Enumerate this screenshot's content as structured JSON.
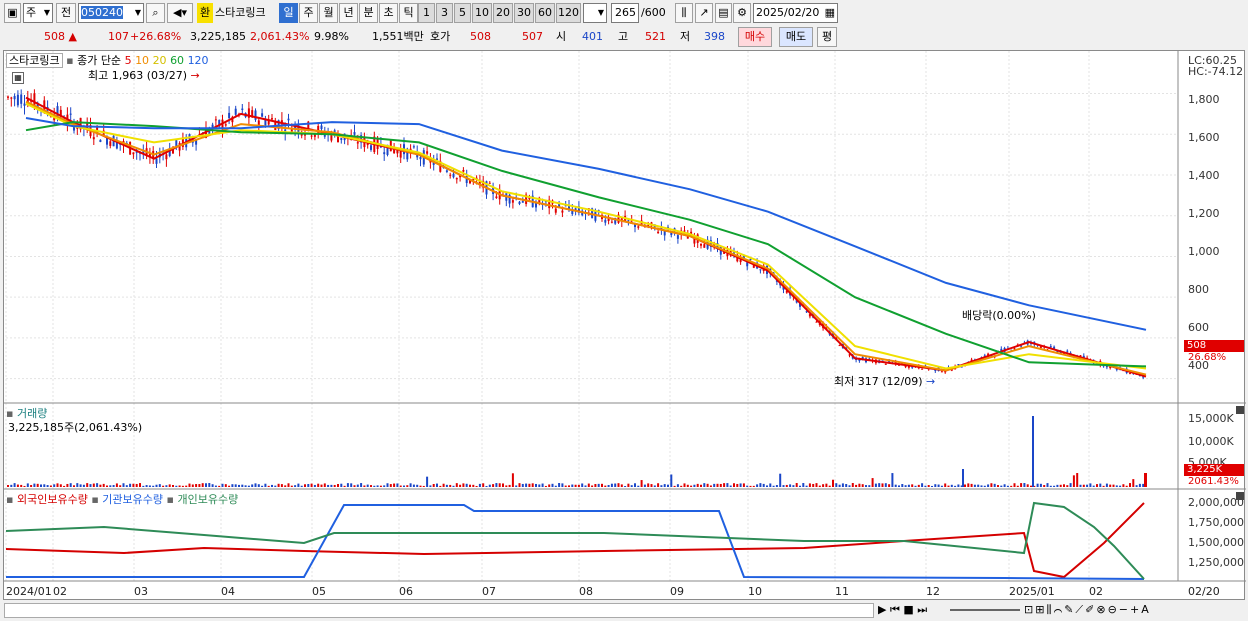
{
  "toolbar": {
    "type_sel": "주",
    "jeon": "전",
    "code": "050240",
    "hwan": "환",
    "stock_name": "스타코링크",
    "periods": [
      "일",
      "주",
      "월",
      "년",
      "분",
      "초",
      "틱"
    ],
    "active_period": "일",
    "minute_units": [
      "1",
      "3",
      "5",
      "10",
      "20",
      "30",
      "60",
      "120"
    ],
    "count": "265",
    "count_max": "/600",
    "date": "2025/02/20"
  },
  "quote": {
    "price": "508 ▲",
    "change": "107",
    "change_pct": "+26.68%",
    "volume": "3,225,185",
    "volume_pct": "2,061.43%",
    "turnover_pct": "9.98%",
    "amount": "1,551백만",
    "hoga_label": "호가",
    "ask": "508",
    "bid": "507",
    "open_label": "시",
    "open": "401",
    "high_label": "고",
    "high": "521",
    "low_label": "저",
    "low": "398",
    "buy": "매수",
    "sell": "매도",
    "even": "평"
  },
  "price_panel": {
    "name": "스타코링크",
    "ma_title": "종가 단순",
    "ma_5": "5",
    "ma_10": "10",
    "ma_20": "20",
    "ma_60": "60",
    "ma_120": "120",
    "high_note": "최고 1,963 (03/27)",
    "low_note": "최저 317 (12/09)",
    "dividend_note": "배당락(0.00%)",
    "lc": "LC:60.25",
    "hc": "HC:-74.12",
    "cur_price": "508",
    "cur_pct": "26.68%",
    "y_ticks": [
      "1,800",
      "1,600",
      "1,400",
      "1,200",
      "1,000",
      "800",
      "600",
      "400"
    ]
  },
  "volume_panel": {
    "title": "거래량",
    "value": "3,225,185주(2,061.43%)",
    "y_ticks": [
      "15,000K",
      "10,000K",
      "5,000K"
    ],
    "cur_volume": "3,225K",
    "cur_pct": "2061.43%"
  },
  "holding_panel": {
    "foreign": "외국인보유수량",
    "inst": "기관보유수량",
    "indiv": "개인보유수량",
    "y_ticks": [
      "2,000,000",
      "1,750,000",
      "1,500,000",
      "1,250,000"
    ]
  },
  "x_axis": {
    "labels": [
      "2024/01",
      "02",
      "03",
      "04",
      "05",
      "06",
      "07",
      "08",
      "09",
      "10",
      "11",
      "12",
      "2025/01",
      "02"
    ],
    "last_date": "02/20"
  },
  "colors": {
    "ma5": "#e00000",
    "ma10": "#f08c00",
    "ma20": "#f0e000",
    "ma60": "#10a030",
    "ma120": "#2060e0",
    "up": "#e00000",
    "down": "#1a46c8",
    "foreign": "#d40000",
    "inst": "#2060e0",
    "indiv": "#2e8b57"
  },
  "chart_data": {
    "type": "line",
    "title": "스타코링크",
    "x": [
      "2024/01",
      "02",
      "03",
      "04",
      "05",
      "06",
      "07",
      "08",
      "09",
      "10",
      "11",
      "12",
      "2025/01",
      "02"
    ],
    "series": [
      {
        "name": "5",
        "values": [
          1780,
          1660,
          1480,
          1700,
          1600,
          1500,
          1300,
          1200,
          1100,
          930,
          500,
          440,
          580,
          410
        ]
      },
      {
        "name": "10",
        "values": [
          1760,
          1650,
          1500,
          1650,
          1610,
          1500,
          1300,
          1200,
          1100,
          940,
          520,
          440,
          560,
          420
        ]
      },
      {
        "name": "20",
        "values": [
          1750,
          1640,
          1560,
          1620,
          1600,
          1510,
          1320,
          1220,
          1110,
          960,
          560,
          450,
          520,
          450
        ]
      },
      {
        "name": "60",
        "values": [
          1620,
          1660,
          1640,
          1610,
          1600,
          1560,
          1420,
          1290,
          1180,
          1060,
          800,
          620,
          480,
          460
        ]
      },
      {
        "name": "120",
        "values": [
          1680,
          1640,
          1630,
          1630,
          1660,
          1650,
          1520,
          1430,
          1330,
          1220,
          1050,
          870,
          760,
          640
        ]
      }
    ],
    "ylim": [
      300,
      1950
    ]
  }
}
